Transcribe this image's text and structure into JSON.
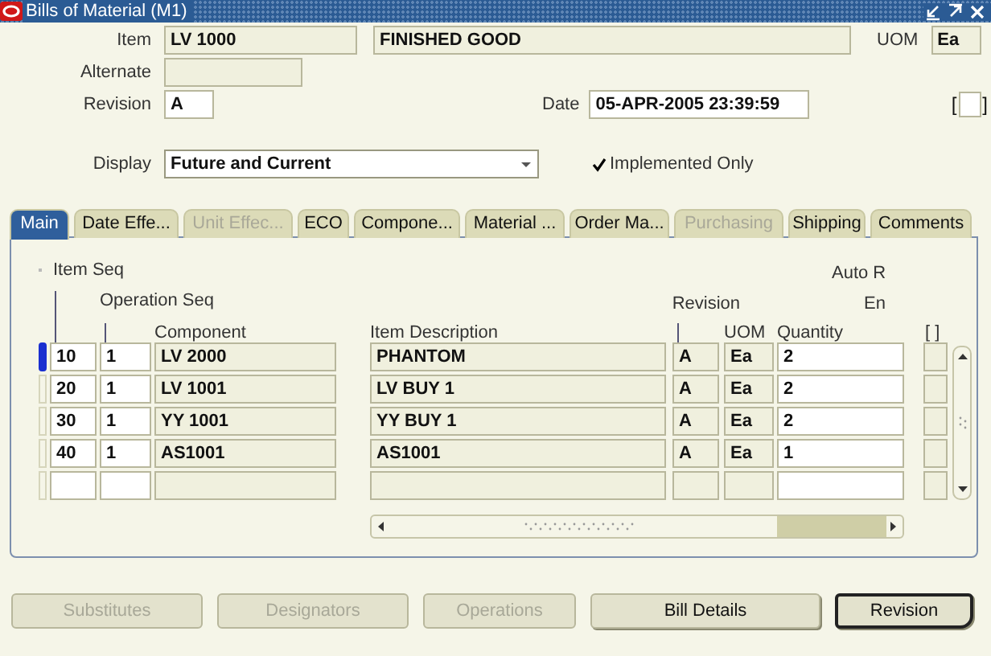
{
  "window": {
    "title": "Bills of Material (M1)"
  },
  "header": {
    "item": {
      "label": "Item",
      "value": "LV 1000"
    },
    "item_description": "FINISHED GOOD",
    "uom": {
      "label": "UOM",
      "value": "Ea"
    },
    "alternate": {
      "label": "Alternate"
    },
    "revision": {
      "label": "Revision",
      "value": "A"
    },
    "date": {
      "label": "Date",
      "value": "05-APR-2005 23:39:59"
    },
    "flex_field": {
      "open": "[",
      "close": "]"
    },
    "display": {
      "label": "Display",
      "value": "Future and Current"
    },
    "implemented_only": {
      "label": "Implemented Only",
      "checked": true
    }
  },
  "tabs": [
    {
      "label": "Main",
      "selected": true,
      "disabled": false
    },
    {
      "label": "Date Effe...",
      "selected": false,
      "disabled": false
    },
    {
      "label": "Unit Effec...",
      "selected": false,
      "disabled": true
    },
    {
      "label": "ECO",
      "selected": false,
      "disabled": false
    },
    {
      "label": "Compone...",
      "selected": false,
      "disabled": false
    },
    {
      "label": "Material ...",
      "selected": false,
      "disabled": false
    },
    {
      "label": "Order Ma...",
      "selected": false,
      "disabled": false
    },
    {
      "label": "Purchasing",
      "selected": false,
      "disabled": true
    },
    {
      "label": "Shipping",
      "selected": false,
      "disabled": false
    },
    {
      "label": "Comments",
      "selected": false,
      "disabled": false
    }
  ],
  "table": {
    "headings": {
      "item_seq": "Item Seq",
      "auto_r": "Auto R",
      "operation_seq": "Operation Seq",
      "revision": "Revision",
      "eng": "En",
      "component": "Component",
      "item_description": "Item Description",
      "uom": "UOM",
      "quantity": "Quantity",
      "flex": "[ ]"
    },
    "columns": [
      {
        "editable": true
      },
      {
        "editable": true
      },
      {
        "editable": false
      },
      {
        "editable": false
      },
      {
        "editable": false
      },
      {
        "editable": false
      },
      {
        "editable": true
      },
      {
        "editable": false
      }
    ],
    "rows": [
      {
        "selected": true,
        "cells": [
          "10",
          "1",
          "LV 2000",
          "PHANTOM",
          "A",
          "Ea",
          "2"
        ]
      },
      {
        "selected": false,
        "cells": [
          "20",
          "1",
          "LV 1001",
          "LV BUY 1",
          "A",
          "Ea",
          "2"
        ]
      },
      {
        "selected": false,
        "cells": [
          "30",
          "1",
          "YY 1001",
          "YY BUY 1",
          "A",
          "Ea",
          "2"
        ]
      },
      {
        "selected": false,
        "cells": [
          "40",
          "1",
          "AS1001",
          "AS1001",
          "A",
          "Ea",
          "1"
        ]
      },
      {
        "selected": false
      }
    ]
  },
  "buttons": [
    {
      "label": "Substitutes",
      "disabled": true,
      "default": false
    },
    {
      "label": "Designators",
      "disabled": true,
      "default": false
    },
    {
      "label": "Operations",
      "disabled": true,
      "default": false
    },
    {
      "label": "Bill Details",
      "disabled": false,
      "default": false
    },
    {
      "label": "Revision",
      "disabled": false,
      "default": true
    }
  ]
}
